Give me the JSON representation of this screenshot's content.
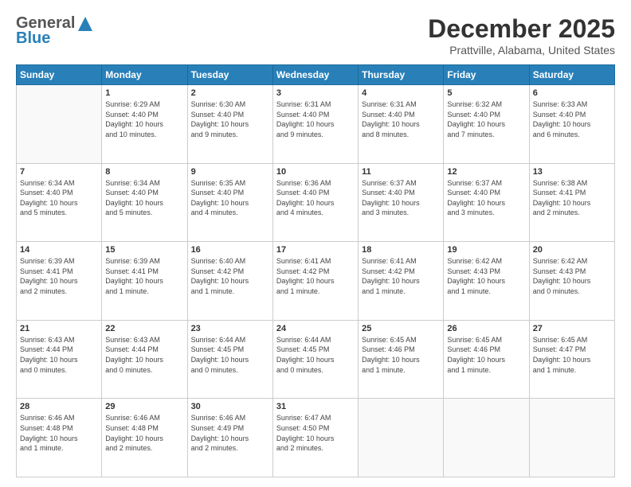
{
  "header": {
    "logo_general": "General",
    "logo_blue": "Blue",
    "month": "December 2025",
    "location": "Prattville, Alabama, United States"
  },
  "days_of_week": [
    "Sunday",
    "Monday",
    "Tuesday",
    "Wednesday",
    "Thursday",
    "Friday",
    "Saturday"
  ],
  "weeks": [
    [
      {
        "day": "",
        "info": ""
      },
      {
        "day": "1",
        "info": "Sunrise: 6:29 AM\nSunset: 4:40 PM\nDaylight: 10 hours\nand 10 minutes."
      },
      {
        "day": "2",
        "info": "Sunrise: 6:30 AM\nSunset: 4:40 PM\nDaylight: 10 hours\nand 9 minutes."
      },
      {
        "day": "3",
        "info": "Sunrise: 6:31 AM\nSunset: 4:40 PM\nDaylight: 10 hours\nand 9 minutes."
      },
      {
        "day": "4",
        "info": "Sunrise: 6:31 AM\nSunset: 4:40 PM\nDaylight: 10 hours\nand 8 minutes."
      },
      {
        "day": "5",
        "info": "Sunrise: 6:32 AM\nSunset: 4:40 PM\nDaylight: 10 hours\nand 7 minutes."
      },
      {
        "day": "6",
        "info": "Sunrise: 6:33 AM\nSunset: 4:40 PM\nDaylight: 10 hours\nand 6 minutes."
      }
    ],
    [
      {
        "day": "7",
        "info": "Sunrise: 6:34 AM\nSunset: 4:40 PM\nDaylight: 10 hours\nand 5 minutes."
      },
      {
        "day": "8",
        "info": "Sunrise: 6:34 AM\nSunset: 4:40 PM\nDaylight: 10 hours\nand 5 minutes."
      },
      {
        "day": "9",
        "info": "Sunrise: 6:35 AM\nSunset: 4:40 PM\nDaylight: 10 hours\nand 4 minutes."
      },
      {
        "day": "10",
        "info": "Sunrise: 6:36 AM\nSunset: 4:40 PM\nDaylight: 10 hours\nand 4 minutes."
      },
      {
        "day": "11",
        "info": "Sunrise: 6:37 AM\nSunset: 4:40 PM\nDaylight: 10 hours\nand 3 minutes."
      },
      {
        "day": "12",
        "info": "Sunrise: 6:37 AM\nSunset: 4:40 PM\nDaylight: 10 hours\nand 3 minutes."
      },
      {
        "day": "13",
        "info": "Sunrise: 6:38 AM\nSunset: 4:41 PM\nDaylight: 10 hours\nand 2 minutes."
      }
    ],
    [
      {
        "day": "14",
        "info": "Sunrise: 6:39 AM\nSunset: 4:41 PM\nDaylight: 10 hours\nand 2 minutes."
      },
      {
        "day": "15",
        "info": "Sunrise: 6:39 AM\nSunset: 4:41 PM\nDaylight: 10 hours\nand 1 minute."
      },
      {
        "day": "16",
        "info": "Sunrise: 6:40 AM\nSunset: 4:42 PM\nDaylight: 10 hours\nand 1 minute."
      },
      {
        "day": "17",
        "info": "Sunrise: 6:41 AM\nSunset: 4:42 PM\nDaylight: 10 hours\nand 1 minute."
      },
      {
        "day": "18",
        "info": "Sunrise: 6:41 AM\nSunset: 4:42 PM\nDaylight: 10 hours\nand 1 minute."
      },
      {
        "day": "19",
        "info": "Sunrise: 6:42 AM\nSunset: 4:43 PM\nDaylight: 10 hours\nand 1 minute."
      },
      {
        "day": "20",
        "info": "Sunrise: 6:42 AM\nSunset: 4:43 PM\nDaylight: 10 hours\nand 0 minutes."
      }
    ],
    [
      {
        "day": "21",
        "info": "Sunrise: 6:43 AM\nSunset: 4:44 PM\nDaylight: 10 hours\nand 0 minutes."
      },
      {
        "day": "22",
        "info": "Sunrise: 6:43 AM\nSunset: 4:44 PM\nDaylight: 10 hours\nand 0 minutes."
      },
      {
        "day": "23",
        "info": "Sunrise: 6:44 AM\nSunset: 4:45 PM\nDaylight: 10 hours\nand 0 minutes."
      },
      {
        "day": "24",
        "info": "Sunrise: 6:44 AM\nSunset: 4:45 PM\nDaylight: 10 hours\nand 0 minutes."
      },
      {
        "day": "25",
        "info": "Sunrise: 6:45 AM\nSunset: 4:46 PM\nDaylight: 10 hours\nand 1 minute."
      },
      {
        "day": "26",
        "info": "Sunrise: 6:45 AM\nSunset: 4:46 PM\nDaylight: 10 hours\nand 1 minute."
      },
      {
        "day": "27",
        "info": "Sunrise: 6:45 AM\nSunset: 4:47 PM\nDaylight: 10 hours\nand 1 minute."
      }
    ],
    [
      {
        "day": "28",
        "info": "Sunrise: 6:46 AM\nSunset: 4:48 PM\nDaylight: 10 hours\nand 1 minute."
      },
      {
        "day": "29",
        "info": "Sunrise: 6:46 AM\nSunset: 4:48 PM\nDaylight: 10 hours\nand 2 minutes."
      },
      {
        "day": "30",
        "info": "Sunrise: 6:46 AM\nSunset: 4:49 PM\nDaylight: 10 hours\nand 2 minutes."
      },
      {
        "day": "31",
        "info": "Sunrise: 6:47 AM\nSunset: 4:50 PM\nDaylight: 10 hours\nand 2 minutes."
      },
      {
        "day": "",
        "info": ""
      },
      {
        "day": "",
        "info": ""
      },
      {
        "day": "",
        "info": ""
      }
    ]
  ]
}
